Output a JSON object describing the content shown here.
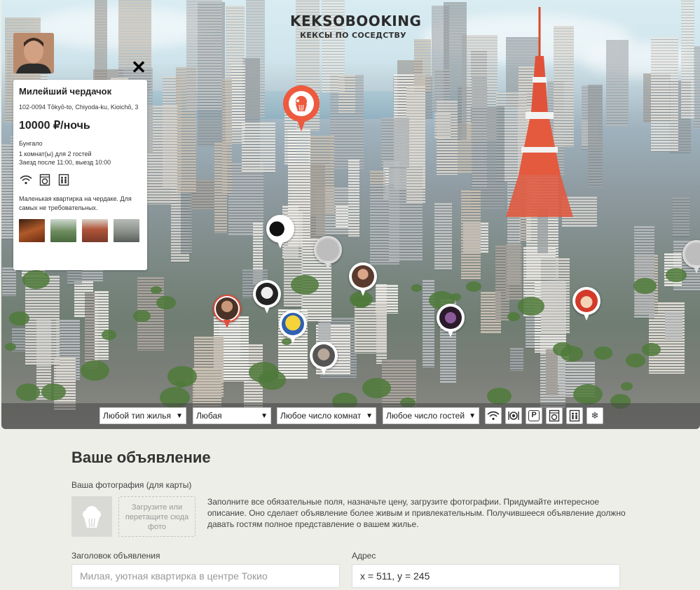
{
  "header": {
    "logo_title": "KEKSOBOOKING",
    "logo_subtitle": "КЕКСЫ ПО СОСЕДСТВУ"
  },
  "card": {
    "title": "Милейший чердачок",
    "address": "102-0094 Tōkyō-to, Chiyoda-ku, Kioichō, 3",
    "price": "10000 ₽/ночь",
    "type": "Бунгало",
    "capacity": "1 комнат(ы) для 2 гостей",
    "time": "Заезд после 11:00, выезд 10:00",
    "features": [
      "wifi-icon",
      "washer-icon",
      "elevator-icon"
    ],
    "description": "Маленькая квартирка на чердаке. Для самых не требовательных.",
    "photos": [
      "#8a4a2a",
      "#6b8a5c",
      "#b0543a",
      "#8b8f8a"
    ],
    "close_symbol": "✕"
  },
  "filters": {
    "housing_type": "Любой тип жилья",
    "price": "Любая",
    "rooms": "Любое число комнат",
    "guests": "Любое число гостей",
    "features": [
      "wifi-icon",
      "dishwasher-icon",
      "parking-icon",
      "washer-icon",
      "elevator-icon",
      "conditioner-icon"
    ]
  },
  "form": {
    "heading": "Ваше объявление",
    "photo_label": "Ваша фотография (для карты)",
    "drop_zone_text": "Загрузите или перетащите сюда фото",
    "hint": "Заполните все обязательные поля, назначьте цену, загрузите фотографии. Придумайте интересное описание. Оно сделает объявление более живым и привлекательным. Получившееся объявление должно давать гостям полное представление о вашем жилье.",
    "title_label": "Заголовок объявления",
    "title_placeholder": "Милая, уютная квартирка в центре Токио",
    "address_label": "Адрес",
    "address_value": "x = 511, y = 245"
  },
  "colors": {
    "accent": "#ee5a3e",
    "pin_border_active": "#e44b3a"
  }
}
